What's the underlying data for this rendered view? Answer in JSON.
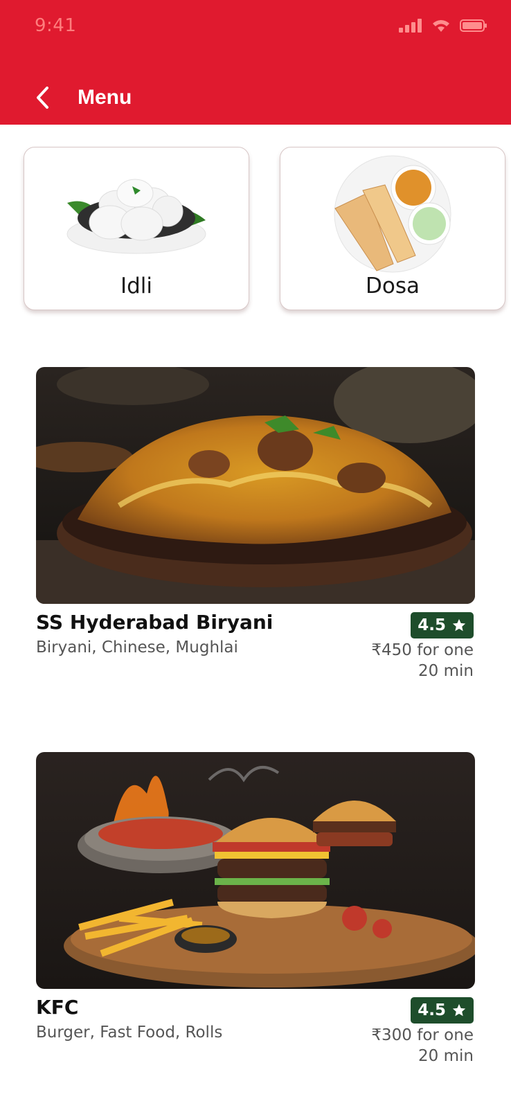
{
  "status_bar": {
    "time": "9:41"
  },
  "header": {
    "title": "Menu"
  },
  "categories": [
    {
      "label": "Idli"
    },
    {
      "label": "Dosa"
    }
  ],
  "restaurants": [
    {
      "name": "SS Hyderabad Biryani",
      "cuisine": "Biryani, Chinese, Mughlai",
      "rating": "4.5",
      "price": "₹450 for one",
      "time": "20 min"
    },
    {
      "name": "KFC",
      "cuisine": "Burger, Fast Food, Rolls",
      "rating": "4.5",
      "price": "₹300 for one",
      "time": "20 min"
    }
  ],
  "colors": {
    "brand": "#e01a2f",
    "rating_bg": "#1e4d2b"
  }
}
